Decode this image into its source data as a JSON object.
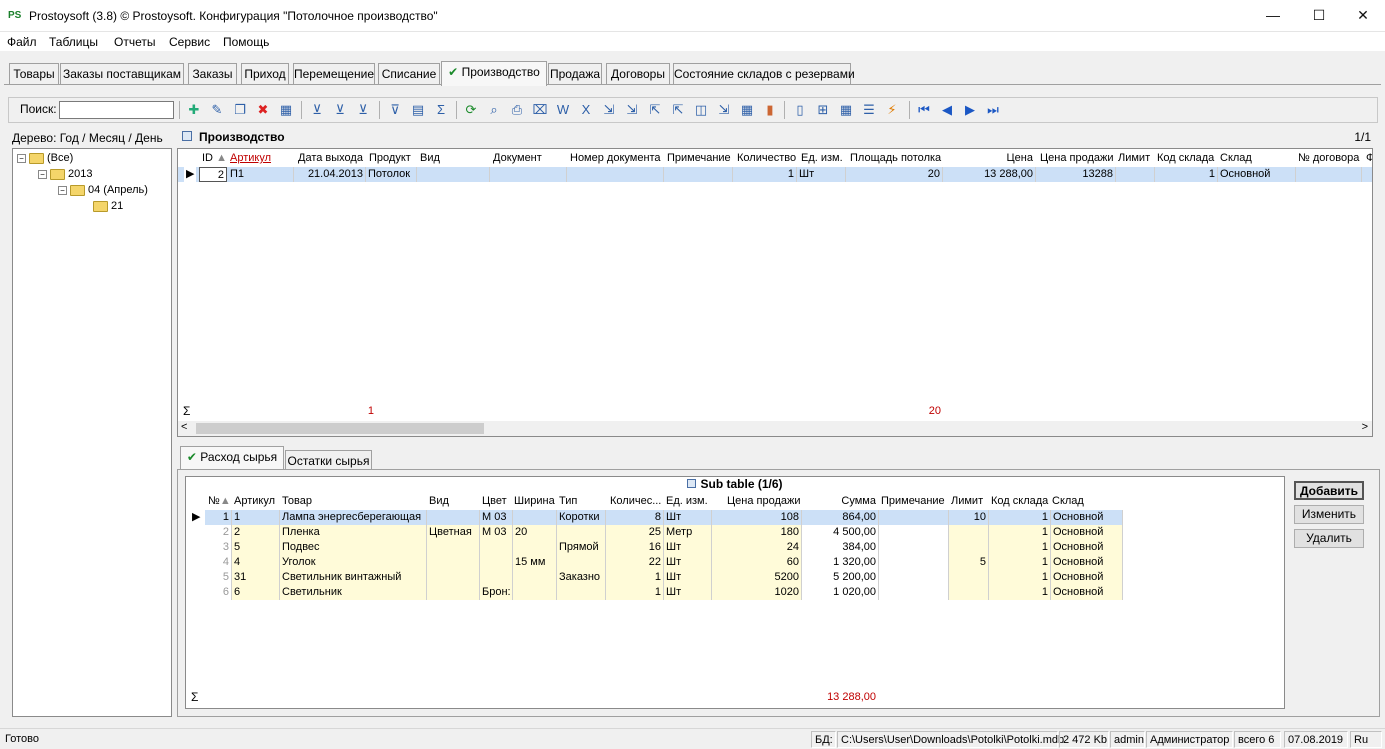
{
  "window": {
    "title": "Prostoysoft (3.8) © Prostoysoft. Конфигурация \"Потолочное производство\"",
    "controls": {
      "minimize": "—",
      "maximize": "☐",
      "close": "✕"
    }
  },
  "menu": [
    "Файл",
    "Таблицы",
    "Отчеты",
    "Сервис",
    "Помощь"
  ],
  "tabs": [
    "Товары",
    "Заказы поставщикам",
    "Заказы",
    "Приход",
    "Перемещение",
    "Списание",
    "Производство",
    "Продажа",
    "Договоры",
    "Состояние складов с резервами"
  ],
  "active_tab_check": "✔",
  "toolbar": {
    "search_label": "Поиск:",
    "search_value": "",
    "icons": [
      "add-icon",
      "edit-icon",
      "copy-icon",
      "delete-icon",
      "delete-all-icon",
      "filter-add-icon",
      "filter-clear-icon",
      "filter-remove-icon",
      "filter-view-icon",
      "tree-view-icon",
      "sql-icon",
      "refresh-icon",
      "find-icon",
      "print-icon",
      "preview-icon",
      "export-word-icon",
      "export-excel-icon",
      "export-icon",
      "export2-icon",
      "import-icon",
      "import2-icon",
      "export-xml-icon",
      "export3-icon",
      "export-xls-icon",
      "chart-icon",
      "doc-icon",
      "new-doc-icon",
      "table-icon",
      "settings-icon",
      "run-icon",
      "first-icon",
      "prev-icon",
      "next-icon",
      "last-icon"
    ]
  },
  "tree": {
    "title": "Дерево: Год / Месяц / День",
    "nodes": [
      "(Все)",
      "2013",
      "04 (Апрель)",
      "21"
    ]
  },
  "main_grid": {
    "title": "Производство",
    "page": "1/1",
    "columns": [
      "ID",
      "Артикул",
      "Дата выхода",
      "Продукт",
      "Вид",
      "Документ",
      "Номер документа",
      "Примечание",
      "Количество",
      "Ед. изм.",
      "Площадь потолка",
      "Цена",
      "Цена продажи",
      "Лимит",
      "Код склада",
      "Склад",
      "№ договора",
      "Ф"
    ],
    "rows": [
      {
        "id": "2",
        "article": "П1",
        "date": "21.04.2013",
        "product": "Потолок",
        "kind": "",
        "doc": "",
        "docnum": "",
        "note": "",
        "qty": "1",
        "unit": "Шт",
        "area": "20",
        "price": "13 288,00",
        "sale_price": "13288",
        "limit": "",
        "store_code": "1",
        "store": "Основной",
        "contract": ""
      }
    ],
    "totals": {
      "qty": "1",
      "area": "20"
    },
    "sigma": "Σ"
  },
  "sub_tabs": [
    "Расход сырья",
    "Остатки сырья"
  ],
  "sub_grid": {
    "title": "Sub table (1/6)",
    "columns": [
      "№",
      "Артикул",
      "Товар",
      "Вид",
      "Цвет",
      "Ширина",
      "Тип",
      "Количес...",
      "Ед. изм.",
      "Цена продажи",
      "Сумма",
      "Примечание",
      "Лимит",
      "Код склада",
      "Склад"
    ],
    "rows": [
      {
        "n": "1",
        "article": "1",
        "name": "Лампа энергесберегающая",
        "kind": "",
        "color": "М 03",
        "width": "",
        "type": "Коротки",
        "qty": "8",
        "unit": "Шт",
        "price": "108",
        "sum": "864,00",
        "note": "",
        "limit": "10",
        "code": "1",
        "store": "Основной"
      },
      {
        "n": "2",
        "article": "2",
        "name": "Пленка",
        "kind": "Цветная",
        "color": "М 03",
        "width": "20",
        "type": "",
        "qty": "25",
        "unit": "Метр",
        "price": "180",
        "sum": "4 500,00",
        "note": "",
        "limit": "",
        "code": "1",
        "store": "Основной"
      },
      {
        "n": "3",
        "article": "5",
        "name": "Подвес",
        "kind": "",
        "color": "",
        "width": "",
        "type": "Прямой",
        "qty": "16",
        "unit": "Шт",
        "price": "24",
        "sum": "384,00",
        "note": "",
        "limit": "",
        "code": "1",
        "store": "Основной"
      },
      {
        "n": "4",
        "article": "4",
        "name": "Уголок",
        "kind": "",
        "color": "",
        "width": "15 мм",
        "type": "",
        "qty": "22",
        "unit": "Шт",
        "price": "60",
        "sum": "1 320,00",
        "note": "",
        "limit": "5",
        "code": "1",
        "store": "Основной"
      },
      {
        "n": "5",
        "article": "31",
        "name": "Светильник винтажный",
        "kind": "",
        "color": "",
        "width": "",
        "type": "Заказно",
        "qty": "1",
        "unit": "Шт",
        "price": "5200",
        "sum": "5 200,00",
        "note": "",
        "limit": "",
        "code": "1",
        "store": "Основной"
      },
      {
        "n": "6",
        "article": "6",
        "name": "Светильник",
        "kind": "",
        "color": "Брон:",
        "width": "",
        "type": "",
        "qty": "1",
        "unit": "Шт",
        "price": "1020",
        "sum": "1 020,00",
        "note": "",
        "limit": "",
        "code": "1",
        "store": "Основной"
      }
    ],
    "total_sum": "13 288,00",
    "sigma": "Σ"
  },
  "buttons": {
    "add": "Добавить",
    "edit": "Изменить",
    "delete": "Удалить"
  },
  "status": {
    "ready": "Готово",
    "db_label": "БД:",
    "db_path": "C:\\Users\\User\\Downloads\\Potolki\\Potolki.mdb",
    "size": "2 472 Kb",
    "user": "admin",
    "role": "Администратор",
    "total": "всего 6",
    "date": "07.08.2019",
    "lang": "Ru"
  },
  "colors": {
    "selected_row": "#cce0f7",
    "edit_cell": "#fffbd9",
    "required_header": "#c00000",
    "accent_green": "#1a8a2a"
  }
}
